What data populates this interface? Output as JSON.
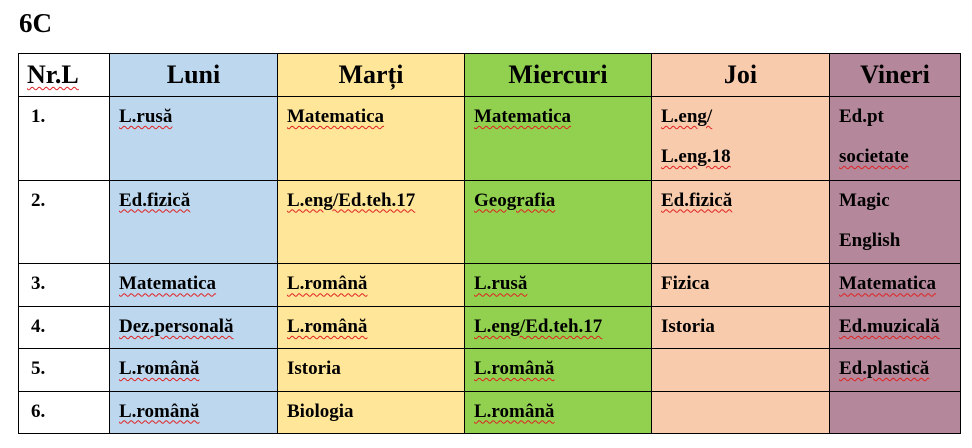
{
  "page": {
    "title": "6C"
  },
  "colors": {
    "luni": "#bdd7ee",
    "marti": "#ffe699",
    "miercuri": "#92d050",
    "joi": "#f8cbad",
    "vineri": "#b4889a"
  },
  "table": {
    "headers": [
      "Nr.L",
      "Luni",
      "Marți",
      "Miercuri",
      "Joi",
      "Vineri"
    ],
    "rows": [
      {
        "nr": "1.",
        "luni": "L.rusă",
        "marti": "Matematica",
        "miercuri": "Matematica",
        "joi": [
          "L.eng/",
          "L.eng.18"
        ],
        "vineri": [
          "Ed.pt",
          "societate"
        ]
      },
      {
        "nr": "2.",
        "luni": "Ed.fizică",
        "marti": "L.eng/Ed.teh.17",
        "miercuri": "Geografia",
        "joi": "Ed.fizică",
        "vineri": [
          "Magic",
          "English"
        ]
      },
      {
        "nr": "3.",
        "luni": "Matematica",
        "marti": "L.română",
        "miercuri": "L.rusă",
        "joi": "Fizica",
        "vineri": "Matematica"
      },
      {
        "nr": "4.",
        "luni": "Dez.personală",
        "marti": "L.română",
        "miercuri": "L.eng/Ed.teh.17",
        "joi": "Istoria",
        "vineri": "Ed.muzicală"
      },
      {
        "nr": "5.",
        "luni": "L.română",
        "marti": "Istoria",
        "miercuri": "L.română",
        "joi": "",
        "vineri": "Ed.plastică"
      },
      {
        "nr": "6.",
        "luni": "L.română",
        "marti": "Biologia",
        "miercuri": "L.română",
        "joi": "",
        "vineri": ""
      }
    ]
  }
}
